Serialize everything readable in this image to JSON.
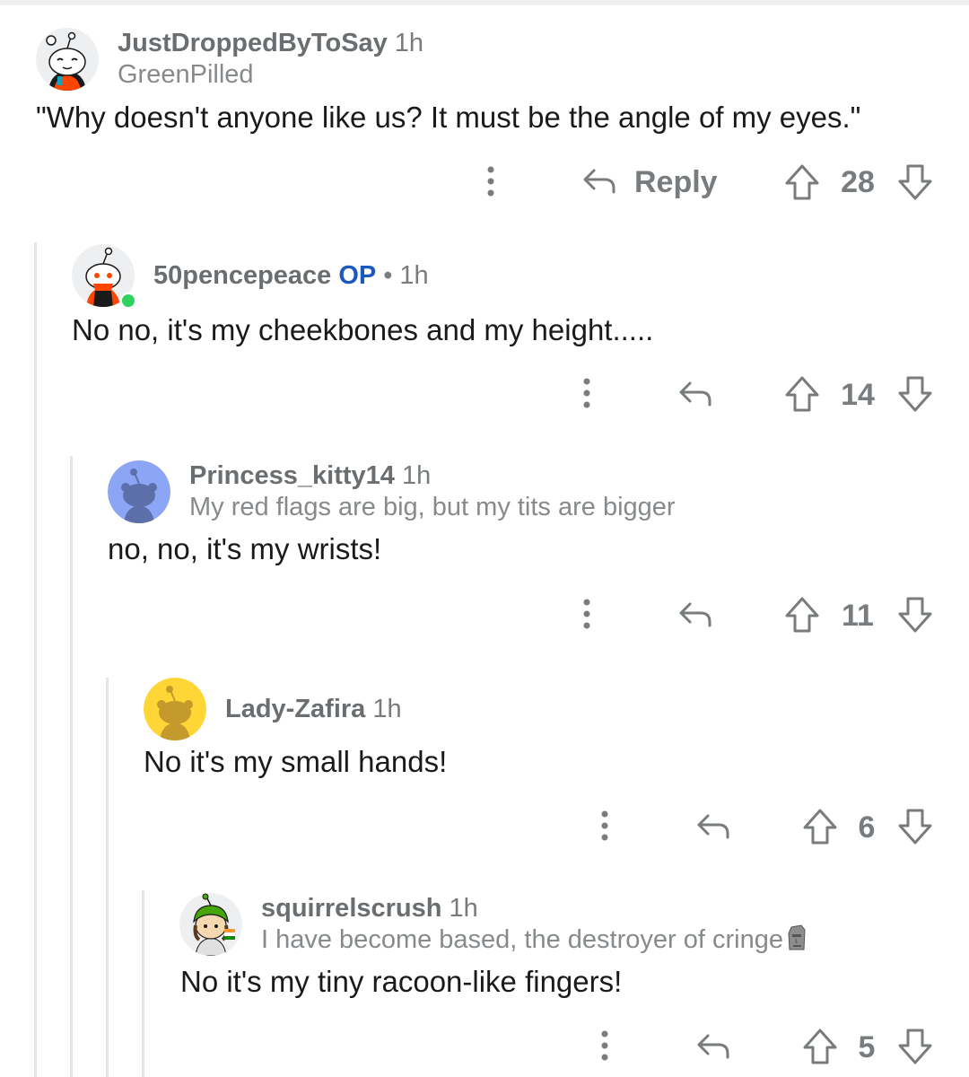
{
  "comments": [
    {
      "username": "JustDroppedByToSay",
      "time": "1h",
      "flair": "GreenPilled",
      "text": "\"Why doesn't anyone like us? It must be the angle of my eyes.\"",
      "reply_label": "Reply",
      "score": "28",
      "avatar_color": "#ff4500"
    },
    {
      "username": "50pencepeace",
      "op_badge": "OP",
      "separator": "•",
      "time": "1h",
      "text": "No no, it's my cheekbones and my height.....",
      "score": "14",
      "avatar_color": "#ff4500",
      "online": true
    },
    {
      "username": "Princess_kitty14",
      "time": "1h",
      "flair": "My red flags are big, but my tits are bigger",
      "text": "no, no, it's my wrists!",
      "score": "11",
      "avatar_color": "#8ca6f5"
    },
    {
      "username": "Lady-Zafira",
      "time": "1h",
      "text": "No it's my small hands!",
      "score": "6",
      "avatar_color": "#ffd635"
    },
    {
      "username": "squirrelscrush",
      "time": "1h",
      "flair": "I have become based, the destroyer of cringe",
      "text": "No it's my tiny racoon-like fingers!",
      "score": "5",
      "avatar_color": "#46a508"
    }
  ],
  "icons": {
    "more": "more-vertical-icon",
    "reply": "reply-arrow-icon",
    "upvote": "upvote-arrow-icon",
    "downvote": "downvote-arrow-icon",
    "flair_emoji": "moai-icon"
  }
}
